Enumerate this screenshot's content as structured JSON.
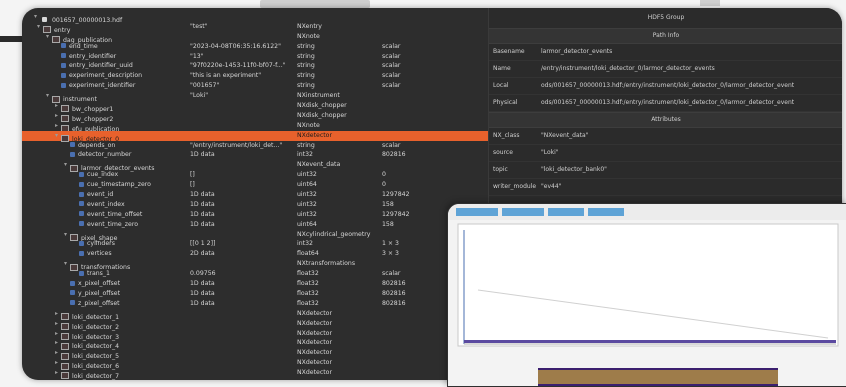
{
  "tree": {
    "root": {
      "label": "001657_00000013.hdf",
      "value": "",
      "type": "",
      "shape": ""
    },
    "rows": [
      {
        "indent": 1,
        "exp": "▾",
        "icon": "grp",
        "name": "entry",
        "value": "\"test\"",
        "type": "NXentry",
        "shape": ""
      },
      {
        "indent": 2,
        "exp": "▾",
        "icon": "grp",
        "name": "dag_publication",
        "value": "",
        "type": "NXnote",
        "shape": ""
      },
      {
        "indent": 3,
        "exp": "",
        "icon": "ds",
        "name": "end_time",
        "value": "\"2023-04-08T06:35:16.6122\"",
        "type": "string",
        "shape": "scalar"
      },
      {
        "indent": 3,
        "exp": "",
        "icon": "ds",
        "name": "entry_identifier",
        "value": "\"13\"",
        "type": "string",
        "shape": "scalar"
      },
      {
        "indent": 3,
        "exp": "",
        "icon": "ds",
        "name": "entry_identifier_uuid",
        "value": "\"97f0220e-1453-11f0-bf07-f...\"",
        "type": "string",
        "shape": "scalar"
      },
      {
        "indent": 3,
        "exp": "",
        "icon": "ds",
        "name": "experiment_description",
        "value": "\"this is an experiment\"",
        "type": "string",
        "shape": "scalar"
      },
      {
        "indent": 3,
        "exp": "",
        "icon": "ds",
        "name": "experiment_identifier",
        "value": "\"001657\"",
        "type": "string",
        "shape": "scalar"
      },
      {
        "indent": 2,
        "exp": "▾",
        "icon": "grp",
        "name": "instrument",
        "value": "\"Loki\"",
        "type": "NXinstrument",
        "shape": ""
      },
      {
        "indent": 3,
        "exp": "▸",
        "icon": "grp",
        "name": "bw_chopper1",
        "value": "",
        "type": "NXdisk_chopper",
        "shape": ""
      },
      {
        "indent": 3,
        "exp": "▸",
        "icon": "grp",
        "name": "bw_chopper2",
        "value": "",
        "type": "NXdisk_chopper",
        "shape": ""
      },
      {
        "indent": 3,
        "exp": "▸",
        "icon": "grp",
        "name": "efu_publication",
        "value": "",
        "type": "NXnote",
        "shape": ""
      },
      {
        "indent": 3,
        "exp": "▾",
        "icon": "grp",
        "name": "loki_detector_0",
        "value": "",
        "type": "NXdetector",
        "shape": "",
        "selected": true
      },
      {
        "indent": 4,
        "exp": "",
        "icon": "ds",
        "name": "depends_on",
        "value": "\"/entry/instrument/loki_det...\"",
        "type": "string",
        "shape": "scalar"
      },
      {
        "indent": 4,
        "exp": "",
        "icon": "ds",
        "name": "detector_number",
        "value": "1D data",
        "type": "int32",
        "shape": "802816"
      },
      {
        "indent": 4,
        "exp": "▾",
        "icon": "grp",
        "name": "larmor_detector_events",
        "value": "",
        "type": "NXevent_data",
        "shape": ""
      },
      {
        "indent": 5,
        "exp": "",
        "icon": "ds",
        "name": "cue_index",
        "value": "[]",
        "type": "uint32",
        "shape": "0"
      },
      {
        "indent": 5,
        "exp": "",
        "icon": "ds",
        "name": "cue_timestamp_zero",
        "value": "[]",
        "type": "uint64",
        "shape": "0"
      },
      {
        "indent": 5,
        "exp": "",
        "icon": "ds",
        "name": "event_id",
        "value": "1D data",
        "type": "uint32",
        "shape": "1297842"
      },
      {
        "indent": 5,
        "exp": "",
        "icon": "ds",
        "name": "event_index",
        "value": "1D data",
        "type": "uint32",
        "shape": "158"
      },
      {
        "indent": 5,
        "exp": "",
        "icon": "ds",
        "name": "event_time_offset",
        "value": "1D data",
        "type": "uint32",
        "shape": "1297842"
      },
      {
        "indent": 5,
        "exp": "",
        "icon": "ds",
        "name": "event_time_zero",
        "value": "1D data",
        "type": "uint64",
        "shape": "158"
      },
      {
        "indent": 4,
        "exp": "▾",
        "icon": "grp",
        "name": "pixel_shape",
        "value": "",
        "type": "NXcylindrical_geometry",
        "shape": ""
      },
      {
        "indent": 5,
        "exp": "",
        "icon": "ds",
        "name": "cylinders",
        "value": "[[0 1 2]]",
        "type": "int32",
        "shape": "1 × 3"
      },
      {
        "indent": 5,
        "exp": "",
        "icon": "ds",
        "name": "vertices",
        "value": "2D data",
        "type": "float64",
        "shape": "3 × 3"
      },
      {
        "indent": 4,
        "exp": "▾",
        "icon": "grp",
        "name": "transformations",
        "value": "",
        "type": "NXtransformations",
        "shape": ""
      },
      {
        "indent": 5,
        "exp": "",
        "icon": "ds",
        "name": "trans_1",
        "value": "0.09756",
        "type": "float32",
        "shape": "scalar"
      },
      {
        "indent": 4,
        "exp": "",
        "icon": "ds",
        "name": "x_pixel_offset",
        "value": "1D data",
        "type": "float32",
        "shape": "802816"
      },
      {
        "indent": 4,
        "exp": "",
        "icon": "ds",
        "name": "y_pixel_offset",
        "value": "1D data",
        "type": "float32",
        "shape": "802816"
      },
      {
        "indent": 4,
        "exp": "",
        "icon": "ds",
        "name": "z_pixel_offset",
        "value": "1D data",
        "type": "float32",
        "shape": "802816"
      },
      {
        "indent": 3,
        "exp": "▸",
        "icon": "grp",
        "name": "loki_detector_1",
        "value": "",
        "type": "NXdetector",
        "shape": ""
      },
      {
        "indent": 3,
        "exp": "▸",
        "icon": "grp",
        "name": "loki_detector_2",
        "value": "",
        "type": "NXdetector",
        "shape": ""
      },
      {
        "indent": 3,
        "exp": "▸",
        "icon": "grp",
        "name": "loki_detector_3",
        "value": "",
        "type": "NXdetector",
        "shape": ""
      },
      {
        "indent": 3,
        "exp": "▸",
        "icon": "grp",
        "name": "loki_detector_4",
        "value": "",
        "type": "NXdetector",
        "shape": ""
      },
      {
        "indent": 3,
        "exp": "▸",
        "icon": "grp",
        "name": "loki_detector_5",
        "value": "",
        "type": "NXdetector",
        "shape": ""
      },
      {
        "indent": 3,
        "exp": "▸",
        "icon": "grp",
        "name": "loki_detector_6",
        "value": "",
        "type": "NXdetector",
        "shape": ""
      },
      {
        "indent": 3,
        "exp": "▸",
        "icon": "grp",
        "name": "loki_detector_7",
        "value": "",
        "type": "NXdetector",
        "shape": ""
      }
    ]
  },
  "props": {
    "title": "HDF5 Group",
    "paths_header": "Path Info",
    "paths": [
      {
        "key": "Basename",
        "value": "larmor_detector_events"
      },
      {
        "key": "Name",
        "value": "/entry/instrument/loki_detector_0/larmor_detector_events"
      },
      {
        "key": "Local",
        "value": "ods/001657_00000013.hdf:/entry/instrument/loki_detector_0/larmor_detector_event"
      },
      {
        "key": "Physical",
        "value": "ods/001657_00000013.hdf:/entry/instrument/loki_detector_0/larmor_detector_event"
      }
    ],
    "attrs_header": "Attributes",
    "attrs": [
      {
        "key": "NX_class",
        "value": "\"NXevent_data\""
      },
      {
        "key": "source",
        "value": "\"Loki\""
      },
      {
        "key": "topic",
        "value": "\"loki_detector_bank0\""
      },
      {
        "key": "writer_module",
        "value": "\"ev44\""
      }
    ]
  },
  "colors": {
    "selection": "#e8612c",
    "window_bg": "#2d2d2d",
    "plot_line": "#5b4aa0",
    "heatmap_low": "#3b1f6e",
    "heatmap_high": "#f0d24a"
  }
}
